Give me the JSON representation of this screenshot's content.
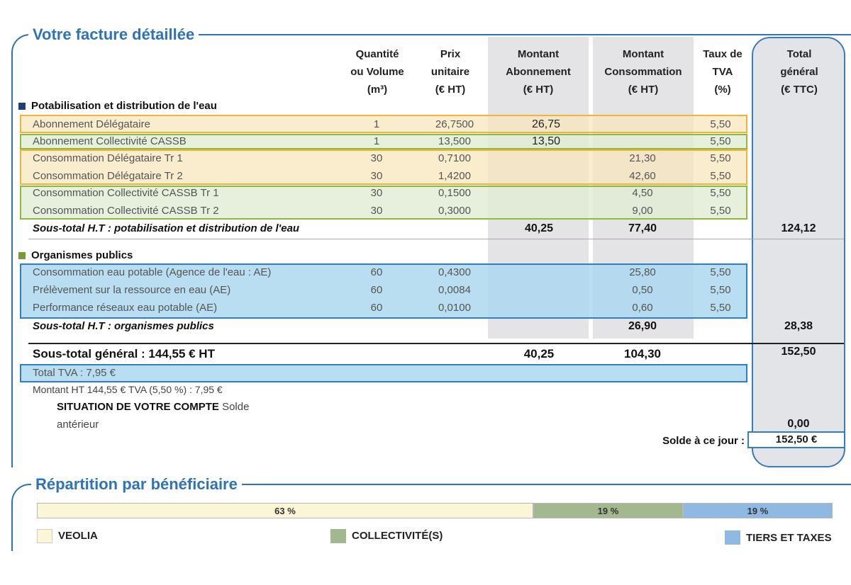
{
  "invoice": {
    "title": "Votre facture détaillée",
    "columns": {
      "qty": [
        "Quantité",
        "ou Volume",
        "(m³)"
      ],
      "pu": [
        "Prix",
        "unitaire",
        "(€ HT)"
      ],
      "abo": [
        "Montant",
        "Abonnement",
        "(€ HT)"
      ],
      "conso": [
        "Montant",
        "Consommation",
        "(€ HT)"
      ],
      "tva": [
        "Taux de",
        "TVA",
        "(%)"
      ],
      "total": [
        "Total",
        "général",
        "(€ TTC)"
      ]
    },
    "section1": {
      "title": "Potabilisation et distribution de l'eau",
      "rows": [
        {
          "label": "Abonnement Délégataire",
          "qty": "1",
          "pu": "26,7500",
          "abo": "26,75",
          "conso": "",
          "tva": "5,50"
        },
        {
          "label": "Abonnement Collectivité CASSB",
          "qty": "1",
          "pu": "13,500",
          "abo": "13,50",
          "conso": "",
          "tva": "5,50"
        },
        {
          "label": "Consommation Délégataire  Tr 1",
          "qty": "30",
          "pu": "0,7100",
          "abo": "",
          "conso": "21,30",
          "tva": "5,50"
        },
        {
          "label": "Consommation Délégataire  Tr 2",
          "qty": "30",
          "pu": "1,4200",
          "abo": "",
          "conso": "42,60",
          "tva": "5,50"
        },
        {
          "label": "Consommation Collectivité CASSB  Tr 1",
          "qty": "30",
          "pu": "0,1500",
          "abo": "",
          "conso": "4,50",
          "tva": "5,50"
        },
        {
          "label": "Consommation Collectivité CASSB  Tr 2",
          "qty": "30",
          "pu": "0,3000",
          "abo": "",
          "conso": "9,00",
          "tva": "5,50"
        }
      ],
      "subtotal": {
        "label": "Sous-total H.T : potabilisation et distribution de l'eau",
        "abo": "40,25",
        "conso": "77,40",
        "total": "124,12"
      }
    },
    "section2": {
      "title": "Organismes publics",
      "rows": [
        {
          "label": "Consommation eau potable (Agence de l'eau : AE)",
          "qty": "60",
          "pu": "0,4300",
          "conso": "25,80",
          "tva": "5,50"
        },
        {
          "label": "Prélèvement sur la ressource en eau (AE)",
          "qty": "60",
          "pu": "0,0084",
          "conso": "0,50",
          "tva": "5,50"
        },
        {
          "label": "Performance réseaux eau potable (AE)",
          "qty": "60",
          "pu": "0,0100",
          "conso": "0,60",
          "tva": "5,50"
        }
      ],
      "subtotal": {
        "label": "Sous-total H.T : organismes publics",
        "conso": "26,90",
        "total": "28,38"
      }
    },
    "general": {
      "label": "Sous-total général : 144,55 € HT",
      "abo": "40,25",
      "conso": "104,30",
      "total": "152,50"
    },
    "tva_total": "Total TVA : 7,95 €",
    "tva_detail": "Montant HT 144,55 € TVA (5,50 %) : 7,95 €",
    "account": {
      "bold": "SITUATION DE VOTRE COMPTE",
      "rest1": " Solde",
      "rest2": "antérieur",
      "previous": "0,00"
    },
    "solde": {
      "label": "Solde à ce jour :",
      "value": "152,50 €"
    }
  },
  "repartition": {
    "title": "Répartition par bénéficiaire",
    "segments": [
      {
        "label": "63 %",
        "value": 63,
        "color": "#fbf6d6"
      },
      {
        "label": "19 %",
        "value": 19,
        "color": "#a2b88e"
      },
      {
        "label": "19 %",
        "value": 19,
        "color": "#8fb9e3"
      }
    ],
    "legend": [
      "VEOLIA",
      "COLLECTIVITÉ(S)",
      "TIERS ET TAXES"
    ]
  }
}
